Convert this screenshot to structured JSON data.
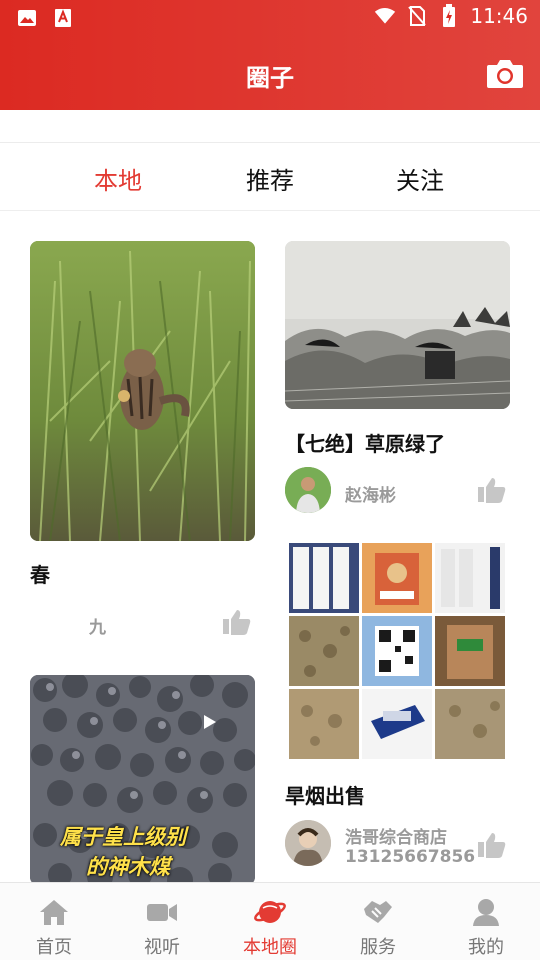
{
  "status_bar": {
    "time": "11:46",
    "icons_left": [
      "gallery-icon",
      "app-a-icon"
    ],
    "icons_right": [
      "wifi-icon",
      "no-sim-icon",
      "battery-charging-icon"
    ]
  },
  "header": {
    "title": "圈子",
    "camera_icon": "camera-icon"
  },
  "tabs": [
    {
      "label": "本地",
      "active": true
    },
    {
      "label": "推荐",
      "active": false
    },
    {
      "label": "关注",
      "active": false
    }
  ],
  "feed": {
    "left": [
      {
        "title": "春",
        "author": "九",
        "image": "chipmunk-in-grass"
      },
      {
        "image": "coal-video",
        "overlay_text": [
          "属于皇上级别",
          "的神木煤"
        ],
        "play_icon": "play-icon"
      }
    ],
    "right": [
      {
        "title": "【七绝】草原绿了",
        "author": "赵海彬",
        "image": "grassland-ruins"
      },
      {
        "title": "旱烟出售",
        "author": "浩哥综合商店",
        "author_sub": "13125667856",
        "image": "tobacco-grid"
      }
    ]
  },
  "bottom_nav": [
    {
      "label": "首页",
      "icon": "home-icon",
      "active": false
    },
    {
      "label": "视听",
      "icon": "video-camera-icon",
      "active": false
    },
    {
      "label": "本地圈",
      "icon": "planet-icon",
      "active": true
    },
    {
      "label": "服务",
      "icon": "handshake-icon",
      "active": false
    },
    {
      "label": "我的",
      "icon": "user-icon",
      "active": false
    }
  ],
  "colors": {
    "brand_red": "#e1342c",
    "active_tab": "#e33b33",
    "muted_text": "#9a9a9a"
  }
}
